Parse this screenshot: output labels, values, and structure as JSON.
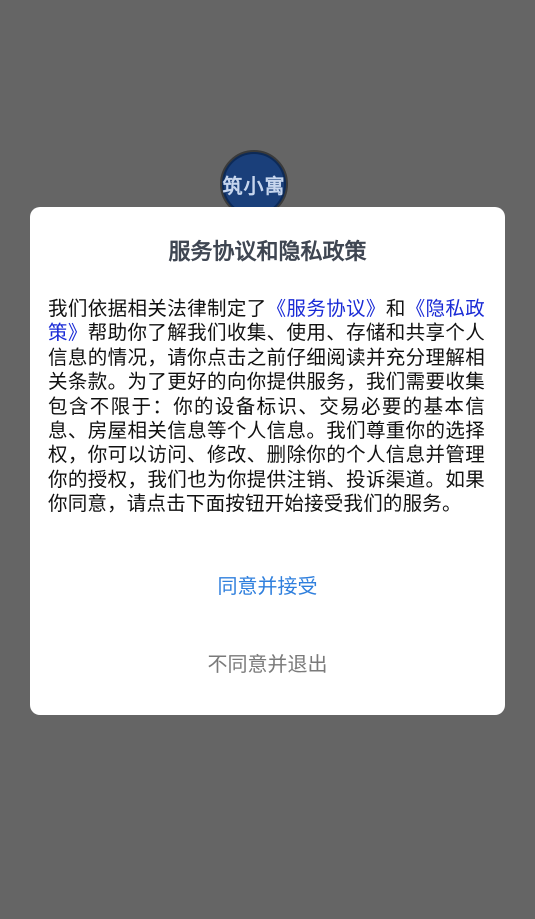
{
  "logo": {
    "text": "筑小寓"
  },
  "dialog": {
    "title": "服务协议和隐私政策",
    "body_part1": "我们依据相关法律制定了",
    "link_service": "《服务协议》",
    "body_and": "和",
    "link_privacy": "《隐私政策》",
    "body_part2": "帮助你了解我们收集、使用、存储和共享个人信息的情况，请你点击之前仔细阅读并充分理解相关条款。为了更好的向你提供服务，我们需要收集包含不限于：你的设备标识、交易必要的基本信息、房屋相关信息等个人信息。我们尊重你的选择权，你可以访问、修改、删除你的个人信息并管理你的授权，我们也为你提供注销、投诉渠道。如果你同意，请点击下面按钮开始接受我们的服务。",
    "accept_label": "同意并接受",
    "decline_label": "不同意并退出"
  },
  "colors": {
    "backdrop": "#656565",
    "link": "#1a2bd6",
    "accept": "#2f7fdd",
    "decline": "#7a7a7a"
  }
}
